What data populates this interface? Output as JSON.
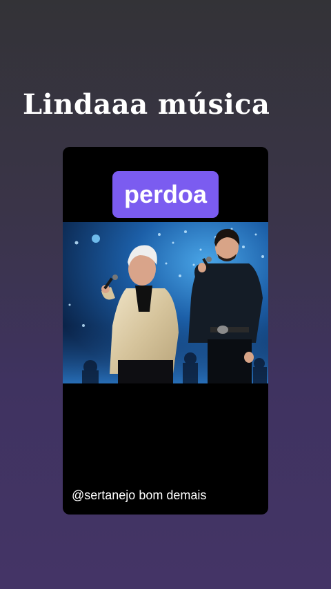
{
  "story": {
    "headline": "Lindaaa música",
    "card": {
      "title": "perdoa",
      "handle": "@sertanejo bom demais"
    }
  },
  "colors": {
    "background_top": "#333337",
    "background_bottom": "#443466",
    "badge": "#7b5cf0",
    "card": "#000000"
  }
}
